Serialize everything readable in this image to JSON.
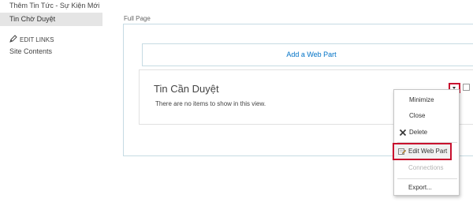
{
  "leftnav": {
    "items": [
      {
        "label": "Thêm Tin Tức - Sự Kiện Mới"
      },
      {
        "label": "Tin Chờ Duyệt"
      }
    ],
    "edit_links": "EDIT LINKS",
    "site_contents": "Site Contents"
  },
  "zone": {
    "label": "Full Page",
    "add_web_part": "Add a Web Part"
  },
  "webpart": {
    "title": "Tin Cần Duyệt",
    "empty_message": "There are no items to show in this view."
  },
  "menu": {
    "items": [
      {
        "label": "Minimize"
      },
      {
        "label": "Close"
      },
      {
        "label": "Delete"
      },
      {
        "label": "Edit Web Part"
      },
      {
        "label": "Connections"
      },
      {
        "label": "Export..."
      }
    ]
  },
  "colors": {
    "accent": "#0072c6",
    "highlight_border": "#c8102e",
    "selected_nav_bg": "#e5e5e5"
  },
  "icons": {
    "edit_links": "pencil-icon",
    "delete": "delete-x-icon",
    "edit_web_part": "edit-web-part-icon",
    "web_part_menu": "chevron-down-icon"
  }
}
